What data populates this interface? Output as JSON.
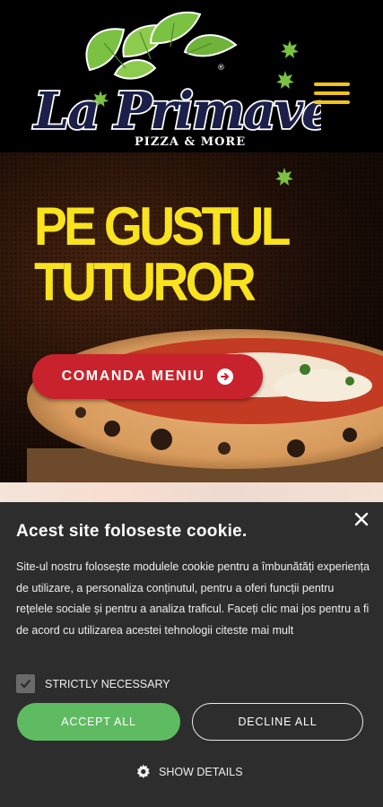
{
  "header": {
    "logo_text": "La Primavera",
    "logo_tagline": "PIZZA & MORE",
    "logo_mark": "®",
    "menu_icon": "hamburger-menu-icon"
  },
  "hero": {
    "title_line1": "PE GUSTUL",
    "title_line2": "TUTUROR",
    "cta_label": "COMANDA MENIU",
    "cta_icon": "arrow-circle-right-icon"
  },
  "cookie": {
    "title": "Acest site foloseste cookie.",
    "body": "Site-ul nostru folosește modulele cookie pentru a îmbunătăți experiența de utilizare, a personaliza conținutul, pentru a oferi funcții pentru rețelele sociale și pentru a analiza traficul. Faceți clic mai jos pentru a fi de acord cu utilizarea acestei tehnologii",
    "more_link": "citeste mai mult",
    "checkbox_label": "STRICTLY NECESSARY",
    "accept_label": "ACCEPT ALL",
    "decline_label": "DECLINE ALL",
    "details_label": "SHOW DETAILS"
  },
  "colors": {
    "accent_yellow": "#f9e21e",
    "cta_red": "#c8232c",
    "accept_green": "#5fbb62",
    "panel_bg": "#2d2d2d",
    "leaf_green": "#7bc142"
  }
}
